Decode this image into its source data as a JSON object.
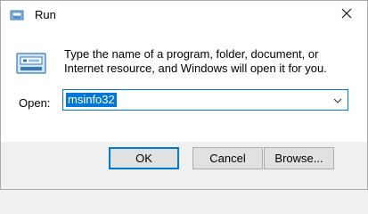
{
  "window": {
    "title": "Run",
    "close_icon": "close-icon",
    "accent_color": "#0078d7"
  },
  "content": {
    "icon": "run-icon",
    "description": "Type the name of a program, folder, document, or Internet resource, and Windows will open it for you.",
    "open_label": "Open:",
    "open_value": "msinfo32",
    "dropdown_icon": "chevron-down-icon"
  },
  "buttons": {
    "ok": "OK",
    "cancel": "Cancel",
    "browse": "Browse..."
  }
}
